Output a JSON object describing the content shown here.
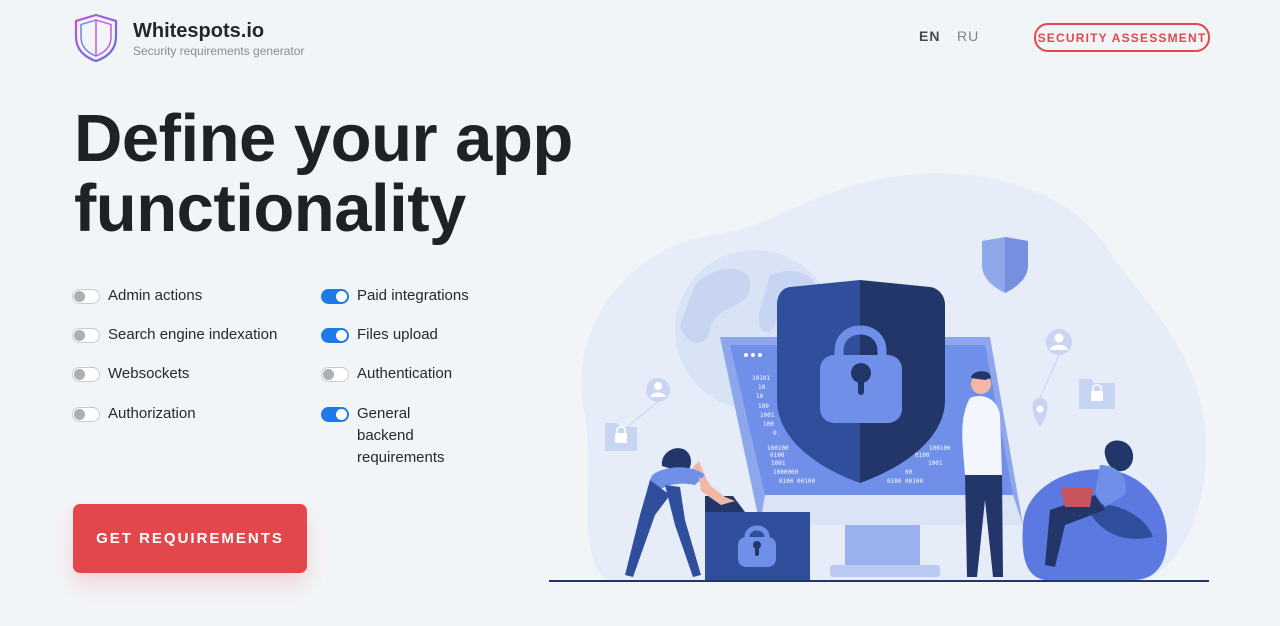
{
  "header": {
    "brand_name": "Whitespots.io",
    "brand_subtitle": "Security requirements generator",
    "logo_icon": "shield-logo-icon",
    "languages": [
      "EN",
      "RU"
    ],
    "active_language": "EN",
    "assessment_button": "SECURITY ASSESSMENT"
  },
  "hero": {
    "headline_line1": "Define your app",
    "headline_line2": "functionality"
  },
  "functionality": {
    "left_column": [
      {
        "label": "Admin actions",
        "enabled": false
      },
      {
        "label": "Search engine indexation",
        "enabled": false
      },
      {
        "label": "Websockets",
        "enabled": false
      },
      {
        "label": "Authorization",
        "enabled": false
      }
    ],
    "right_column": [
      {
        "label": "Paid integrations",
        "enabled": true
      },
      {
        "label": "Files upload",
        "enabled": true
      },
      {
        "label": "Authentication",
        "enabled": false
      },
      {
        "label": "General backend\nrequirements",
        "enabled": true
      }
    ]
  },
  "cta": {
    "label": "GET REQUIREMENTS"
  },
  "colors": {
    "accent_red": "#e2474b",
    "toggle_on": "#1f7ae8",
    "background": "#f2f5f8",
    "illustration_dark": "#23366a",
    "illustration_mid": "#2f4f9c",
    "illustration_light": "#6f8fe8"
  },
  "illustration": {
    "semantic": "security-illustration",
    "code_rows_left": [
      "10101",
      "10",
      "10",
      "100",
      "1001",
      "100",
      "0"
    ],
    "code_rows_bottom_left": [
      "100100",
      "0100",
      "1001",
      "1000000",
      "0100 00100"
    ],
    "code_rows_bottom_right": [
      "100100",
      "0100",
      "1001",
      "00",
      "0100 00100"
    ]
  }
}
